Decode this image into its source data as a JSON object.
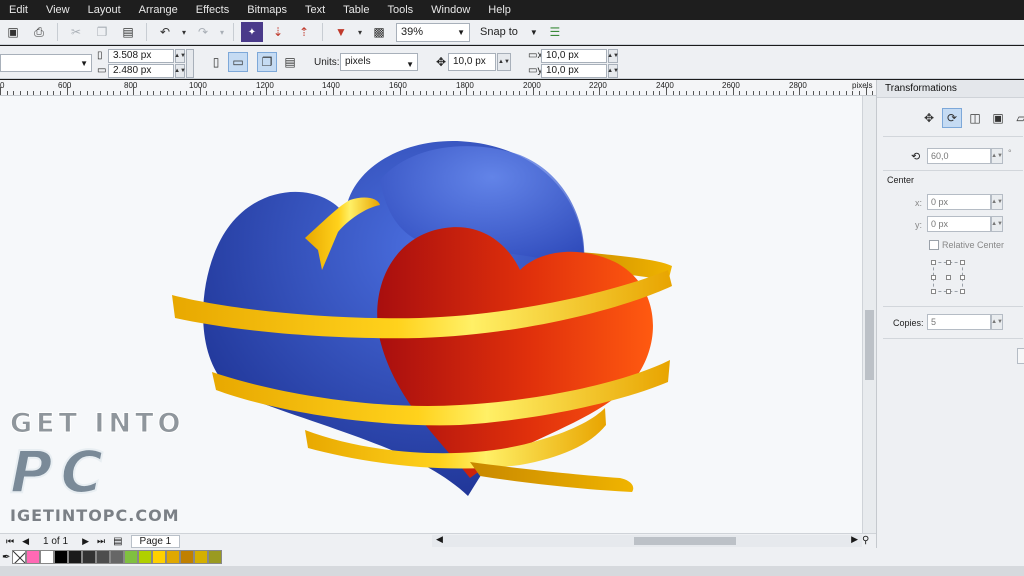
{
  "menu": [
    "Edit",
    "View",
    "Layout",
    "Arrange",
    "Effects",
    "Bitmaps",
    "Text",
    "Table",
    "Tools",
    "Window",
    "Help"
  ],
  "toolbar": {
    "zoom": "39%",
    "snap_to": "Snap to"
  },
  "property_bar": {
    "width": "3.508 px",
    "height": "2.480 px",
    "units_label": "Units:",
    "units_value": "pixels",
    "nudge": "10,0 px",
    "dup_x": "10,0 px",
    "dup_y": "10,0 px"
  },
  "ruler": {
    "labels": [
      "600",
      "800",
      "1000",
      "1200",
      "1400",
      "1600",
      "1800",
      "2000",
      "2200",
      "2400",
      "2600",
      "2800"
    ],
    "unit": "pixels"
  },
  "docker": {
    "title": "Transformations",
    "angle": "60,0",
    "degree_symbol": "°",
    "center_label": "Center",
    "x_label": "x:",
    "x_value": "0 px",
    "y_label": "y:",
    "y_value": "0 px",
    "relative_center": "Relative Center",
    "copies_label": "Copies:",
    "copies_value": "5"
  },
  "pages": {
    "indicator": "1 of 1",
    "tab": "Page 1"
  },
  "palette": [
    "#ff69b4",
    "#ffffff",
    "#000000",
    "#1a1a1a",
    "#333333",
    "#4d4d4d",
    "#666666",
    "#80c040",
    "#b0d000",
    "#ffd000",
    "#e0a800",
    "#c08000",
    "#d4b000",
    "#9a9a20"
  ],
  "watermark": {
    "line1": "GET INTO",
    "line2": "PC",
    "line3": "IGETINTOPC.COM"
  }
}
